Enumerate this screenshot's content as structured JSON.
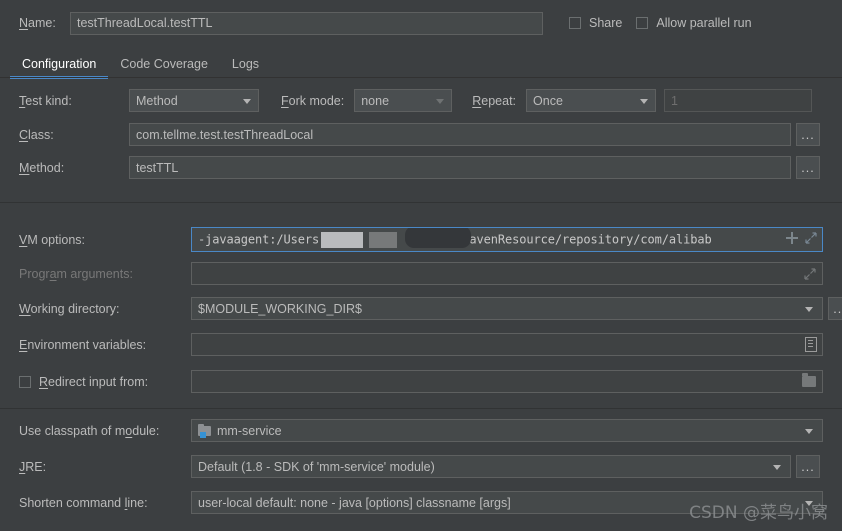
{
  "name_row": {
    "label": "Name:",
    "label_mnemonic": "N",
    "value": "testThreadLocal.testTTL",
    "share_label": "Share",
    "share_checked": false,
    "parallel_label": "Allow parallel run",
    "parallel_checked": false
  },
  "tabs": [
    {
      "label": "Configuration",
      "active": true
    },
    {
      "label": "Code Coverage",
      "active": false
    },
    {
      "label": "Logs",
      "active": false
    }
  ],
  "fields": {
    "test_kind": {
      "label": "Test kind:",
      "label_mnemonic": "T",
      "value": "Method",
      "icon": "chevron-down-icon"
    },
    "fork_mode": {
      "label": "Fork mode:",
      "label_mnemonic": "F",
      "value": "none",
      "icon": "chevron-down-icon",
      "disabled": true
    },
    "repeat": {
      "label": "Repeat:",
      "label_mnemonic": "R",
      "value": "Once",
      "icon": "chevron-down-icon",
      "count_value": "1",
      "count_disabled": true
    },
    "class": {
      "label": "Class:",
      "label_mnemonic": "C",
      "value": "com.tellme.test.testThreadLocal",
      "browse_label": "...",
      "browse_icon": "ellipsis-browse-icon"
    },
    "method": {
      "label": "Method:",
      "label_mnemonic": "M",
      "value": "testTTL",
      "browse_label": "...",
      "browse_icon": "ellipsis-browse-icon"
    },
    "vm_options": {
      "label": "VM options:",
      "label_mnemonic": "V",
      "value_prefix": "-javaagent:/Users",
      "value_suffix": "/mavenResource/repository/com/alibab",
      "redacted": true,
      "focused": true,
      "add_icon": "plus-icon",
      "expand_icon": "expand-icon"
    },
    "program_arguments": {
      "label": "Program arguments:",
      "label_mnemonic": "a",
      "value": "",
      "disabled": true,
      "expand_icon": "expand-icon"
    },
    "working_directory": {
      "label": "Working directory:",
      "label_mnemonic": "W",
      "value": "$MODULE_WORKING_DIR$",
      "icon": "chevron-down-icon",
      "browse_label": "...",
      "browse_icon": "ellipsis-browse-icon"
    },
    "environment_variables": {
      "label": "Environment variables:",
      "label_mnemonic": "E",
      "value": "",
      "icon": "list-edit-icon"
    },
    "redirect_input": {
      "label": "Redirect input from:",
      "label_mnemonic": "R",
      "checked": false,
      "value": "",
      "icon": "folder-icon"
    },
    "classpath_module": {
      "label": "Use classpath of module:",
      "label_mnemonic": "o",
      "value": "mm-service",
      "module_icon": "module-folder-icon",
      "icon": "chevron-down-icon"
    },
    "jre": {
      "label": "JRE:",
      "label_mnemonic": "J",
      "value": "Default (1.8 - SDK of 'mm-service' module)",
      "icon": "chevron-down-icon",
      "browse_label": "...",
      "browse_icon": "ellipsis-browse-icon"
    },
    "shorten_command_line": {
      "label": "Shorten command line:",
      "label_mnemonic": "l",
      "value": "user-local default: none - java [options] classname [args]",
      "icon": "chevron-down-icon"
    }
  },
  "watermark": {
    "text": "CSDN @菜鸟小窝"
  },
  "colors": {
    "background": "#3c3f41",
    "field_background": "#45494a",
    "field_border": "#5e6060",
    "accent": "#4a88c7",
    "text": "#bbbbbb",
    "text_disabled": "#787878",
    "badge_blue": "#3592d4"
  }
}
